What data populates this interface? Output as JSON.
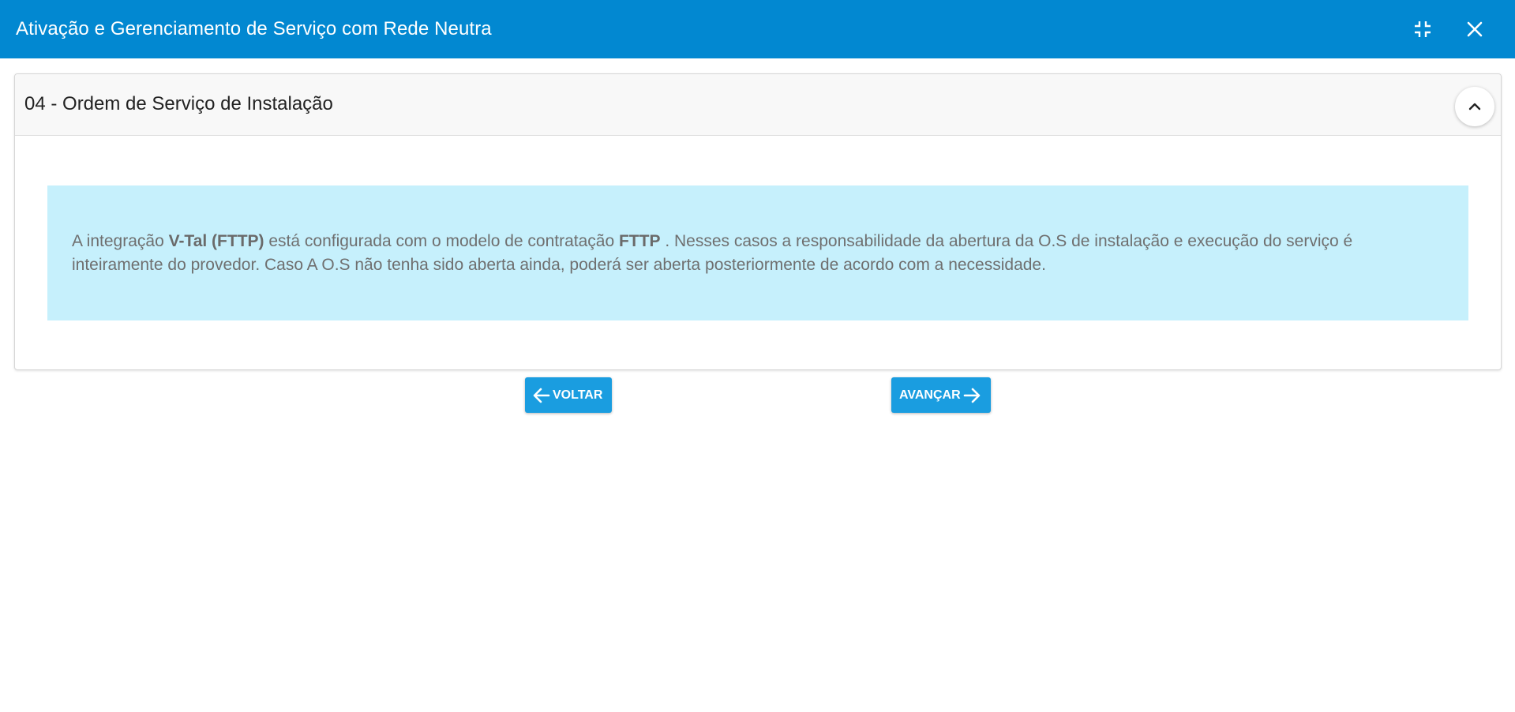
{
  "window": {
    "title": "Ativação e Gerenciamento de Serviço com Rede Neutra",
    "minimize_icon": "compress-icon",
    "close_icon": "close-icon",
    "accent_color": "#0288d1"
  },
  "step": {
    "title": "04 - Ordem de Serviço de Instalação",
    "collapse_icon": "chevron-up-icon"
  },
  "info": {
    "part1": "A integração ",
    "integration": "V-Tal (FTTP)",
    "part2": " está configurada com o modelo de contratação ",
    "model": "FTTP",
    "part3": " . Nesses casos a responsabilidade da abertura da O.S de instalação e execução do serviço é inteiramente do provedor. Caso A O.S não tenha sido aberta ainda, poderá ser aberta posteriormente de acordo com a necessidade.",
    "background_color": "#c6f0fc"
  },
  "navigation": {
    "back_label": "VOLTAR",
    "back_icon": "arrow-left-icon",
    "next_label": "AVANÇAR",
    "next_icon": "arrow-right-icon",
    "button_color": "#1a9de0"
  }
}
